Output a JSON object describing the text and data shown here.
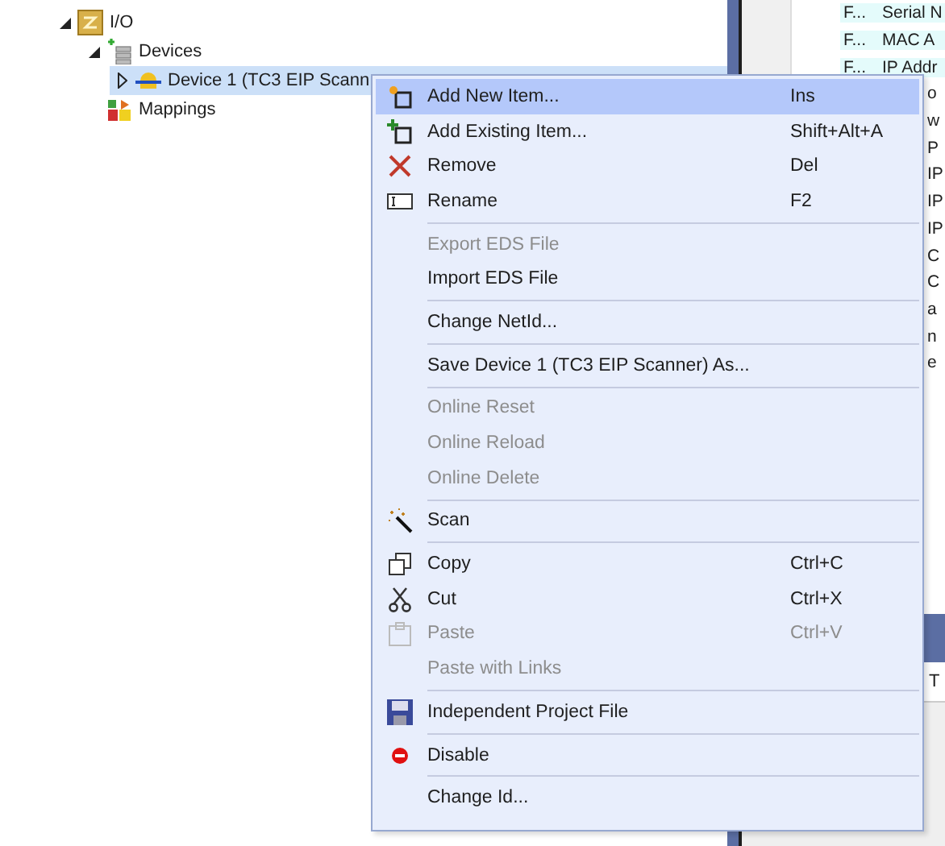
{
  "tree": [
    {
      "label": "I/O",
      "expanded": true,
      "selected": false,
      "children": [
        {
          "label": "Devices",
          "expanded": true,
          "selected": false,
          "children": [
            {
              "label": "Device 1 (TC3 EIP Scann",
              "expanded": false,
              "selected": true
            }
          ]
        },
        {
          "label": "Mappings",
          "selected": false
        }
      ]
    }
  ],
  "grid": {
    "rows": [
      {
        "kind": "full",
        "column_1": "F...",
        "column_2": "Serial N"
      },
      {
        "kind": "full",
        "column_1": "F...",
        "column_2": "MAC A"
      },
      {
        "kind": "full",
        "column_1": "F...",
        "column_2": "IP Addr"
      },
      {
        "kind": "cut",
        "column_2": "o"
      },
      {
        "kind": "cut",
        "column_2": "w"
      },
      {
        "kind": "cut",
        "column_2": "P"
      },
      {
        "kind": "cut",
        "column_2": "IP"
      },
      {
        "kind": "cut",
        "column_2": "IP"
      },
      {
        "kind": "cut",
        "column_2": "IP"
      },
      {
        "kind": "cut",
        "column_2": "C"
      },
      {
        "kind": "cut",
        "column_2": "C"
      },
      {
        "kind": "cut",
        "column_2": "a"
      },
      {
        "kind": "cut",
        "column_2": "n"
      },
      {
        "kind": "cut",
        "column_2": "e"
      }
    ],
    "lower_tab": "T"
  },
  "context_menu": {
    "items": [
      {
        "kind": "item",
        "label": "Add New Item...",
        "shortcut": "Ins",
        "disabled": false,
        "selected": true
      },
      {
        "kind": "item",
        "label": "Add Existing Item...",
        "shortcut": "Shift+Alt+A",
        "disabled": false,
        "selected": false
      },
      {
        "kind": "item",
        "label": "Remove",
        "shortcut": "Del",
        "disabled": false,
        "selected": false
      },
      {
        "kind": "item",
        "label": "Rename",
        "shortcut": "F2",
        "disabled": false,
        "selected": false
      },
      {
        "kind": "separator"
      },
      {
        "kind": "item",
        "label": "Export EDS File",
        "disabled": true,
        "selected": false
      },
      {
        "kind": "item",
        "label": "Import EDS File",
        "disabled": false,
        "selected": false
      },
      {
        "kind": "separator"
      },
      {
        "kind": "item",
        "label": "Change NetId...",
        "disabled": false,
        "selected": false
      },
      {
        "kind": "separator"
      },
      {
        "kind": "item",
        "label": "Save Device 1 (TC3 EIP Scanner) As...",
        "disabled": false,
        "selected": false
      },
      {
        "kind": "separator"
      },
      {
        "kind": "item",
        "label": "Online Reset",
        "disabled": true,
        "selected": false
      },
      {
        "kind": "item",
        "label": "Online Reload",
        "disabled": true,
        "selected": false
      },
      {
        "kind": "item",
        "label": "Online Delete",
        "disabled": true,
        "selected": false
      },
      {
        "kind": "separator"
      },
      {
        "kind": "item",
        "label": "Scan",
        "disabled": false,
        "selected": false
      },
      {
        "kind": "separator"
      },
      {
        "kind": "item",
        "label": "Copy",
        "shortcut": "Ctrl+C",
        "disabled": false,
        "selected": false
      },
      {
        "kind": "item",
        "label": "Cut",
        "shortcut": "Ctrl+X",
        "disabled": false,
        "selected": false
      },
      {
        "kind": "item",
        "label": "Paste",
        "shortcut": "Ctrl+V",
        "disabled": true,
        "selected": false
      },
      {
        "kind": "item",
        "label": "Paste with Links",
        "disabled": true,
        "selected": false
      },
      {
        "kind": "separator"
      },
      {
        "kind": "item",
        "label": "Independent Project File",
        "disabled": false,
        "selected": false
      },
      {
        "kind": "separator"
      },
      {
        "kind": "item",
        "label": "Disable",
        "disabled": false,
        "selected": false
      },
      {
        "kind": "separator"
      },
      {
        "kind": "item",
        "label": "Change Id...",
        "disabled": false,
        "selected": false
      }
    ]
  }
}
